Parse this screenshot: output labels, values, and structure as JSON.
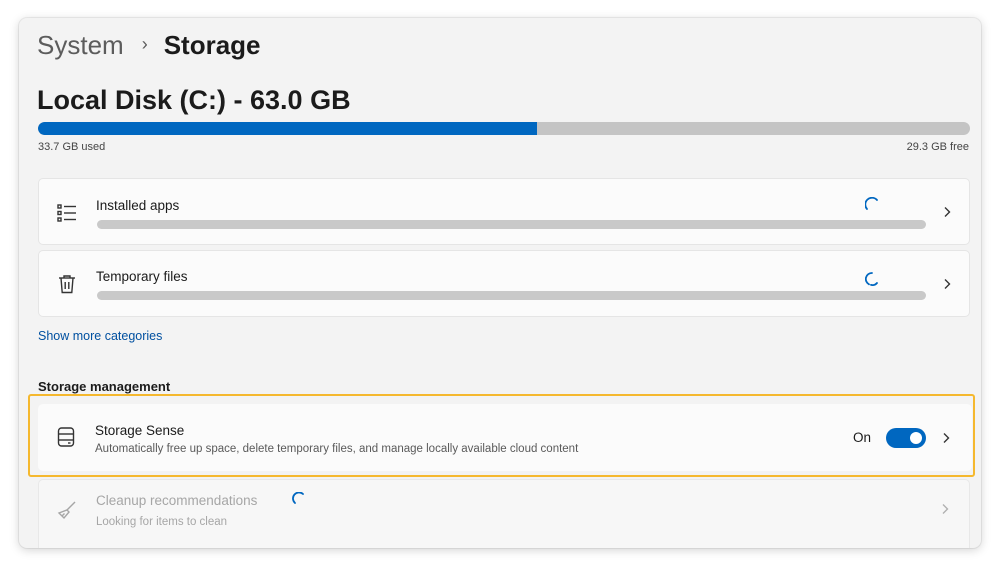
{
  "breadcrumb": {
    "parent": "System",
    "separator": "›",
    "current": "Storage"
  },
  "disk": {
    "title": "Local Disk (C:) - 63.0 GB",
    "used_label": "33.7 GB used",
    "free_label": "29.3 GB free",
    "used_fraction": 0.535,
    "bar_color": "#0067c0",
    "track_color": "#c4c4c4"
  },
  "categories": [
    {
      "label": "Installed apps",
      "icon": "list-icon"
    },
    {
      "label": "Temporary files",
      "icon": "trash-icon"
    }
  ],
  "show_more_label": "Show more categories",
  "storage_management": {
    "heading": "Storage management",
    "storage_sense": {
      "title": "Storage Sense",
      "description": "Automatically free up space, delete temporary files, and manage locally available cloud content",
      "state_label": "On",
      "enabled": true,
      "icon": "storage-drive-icon"
    },
    "cleanup": {
      "title": "Cleanup recommendations",
      "description": "Looking for items to clean",
      "icon": "broom-icon"
    }
  },
  "colors": {
    "accent": "#0067c0",
    "highlight": "#f5b82e",
    "link": "#0050a0"
  }
}
